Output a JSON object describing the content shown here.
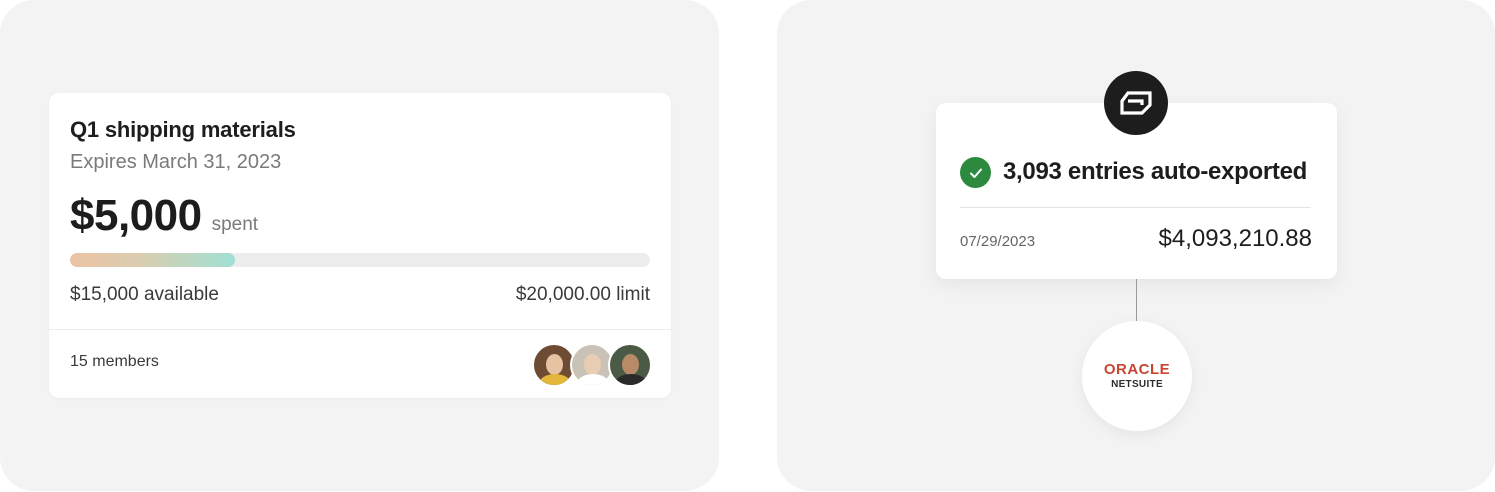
{
  "budget": {
    "title": "Q1 shipping materials",
    "expiry": "Expires March 31, 2023",
    "spent_amount": "$5,000",
    "spent_label": "spent",
    "progress_fraction": 0.285,
    "available": "$15,000 available",
    "limit": "$20,000.00 limit",
    "members": "15 members",
    "avatars": [
      "avatar",
      "avatar",
      "avatar"
    ]
  },
  "export": {
    "brand_icon": "ramp-logo-icon",
    "status_icon": "check-circle-icon",
    "title": "3,093 entries auto-exported",
    "date": "07/29/2023",
    "amount": "$4,093,210.88"
  },
  "integration": {
    "logo_line1": "ORACLE",
    "logo_line2": "NETSUITE"
  },
  "colors": {
    "panel_bg": "#f3f3f3",
    "check_green": "#2b8a3e",
    "oracle_red": "#c74634",
    "badge_dark": "#1d1d1d"
  }
}
